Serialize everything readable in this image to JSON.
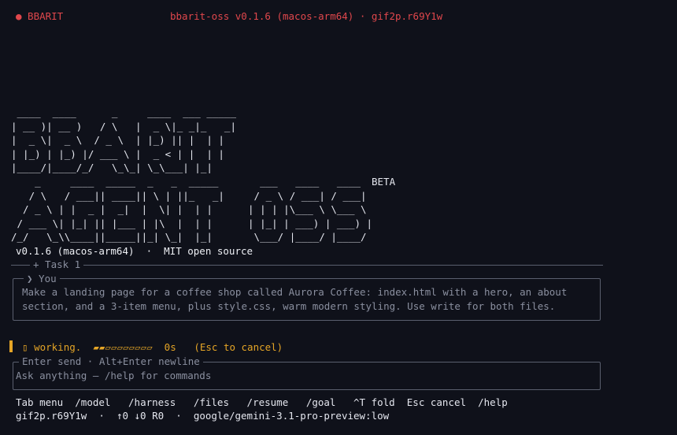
{
  "header": {
    "app_name": "● BBARIT",
    "title": "bbarit-oss v0.1.6 (macos-arm64) · gif2p.r69Y1w"
  },
  "logo": {
    "ascii": " ____  ____      _     ____  ___ _____\n| __ )| __ )   / \\   |  _ \\|_ _|_   _|\n|  _ \\|  _ \\  / _ \\  | |_) || |  | |\n| |_) | |_) |/ ___ \\ |  _ < | |  | |\n|____/|____/_/   \\_\\_| \\_\\___| |_|\n    _     ____  _____  _   _  _____       ___   ____   ____\n   / \\   / ___|| ____|| \\ | ||_   _|     / _ \\ / ___| / ___|\n  / _ \\ | |  _ |  _|  |  \\| |  | |      | | | |\\___ \\ \\___ \\\n / ___ \\| |_| || |___ | |\\  |  | |      | |_| | ___) | ___) |\n/_/   \\_\\\\____||_____||_| \\_|  |_|       \\___/ |____/ |____/",
    "badge": "BETA"
  },
  "version_line": "v0.1.6 (macos-arm64)  ·  MIT open source",
  "task": {
    "label": "+ Task 1"
  },
  "you_panel": {
    "label": "❯ You",
    "message": "Make a landing page for a coffee shop called Aurora Coffee: index.html with a hero, an about section, and a 3-item menu, plus style.css, warm modern styling. Use write for both files."
  },
  "status": {
    "icon": "▯",
    "text": "working.",
    "progress": "▰▰▱▱▱▱▱▱▱▱",
    "progress_fraction": 0.2,
    "elapsed": "0s",
    "cancel_hint": "(Esc to cancel)"
  },
  "input": {
    "hint": "Enter send · Alt+Enter newline",
    "placeholder": "Ask anything — /help for commands",
    "value": ""
  },
  "shortcuts": [
    "Tab menu",
    "/model",
    "/harness",
    "/files",
    "/resume",
    "/goal",
    "^T fold",
    "Esc cancel",
    "/help"
  ],
  "footer": {
    "session": "gif2p.r69Y1w",
    "counters": "↑0 ↓0 R0",
    "model": "google/gemini-3.1-pro-preview:low"
  },
  "colors": {
    "background": "#0f111a",
    "accent_red": "#e0474c",
    "accent_amber": "#e5a526",
    "dim_text": "#8a8f9f",
    "border": "#5a5f6e"
  }
}
